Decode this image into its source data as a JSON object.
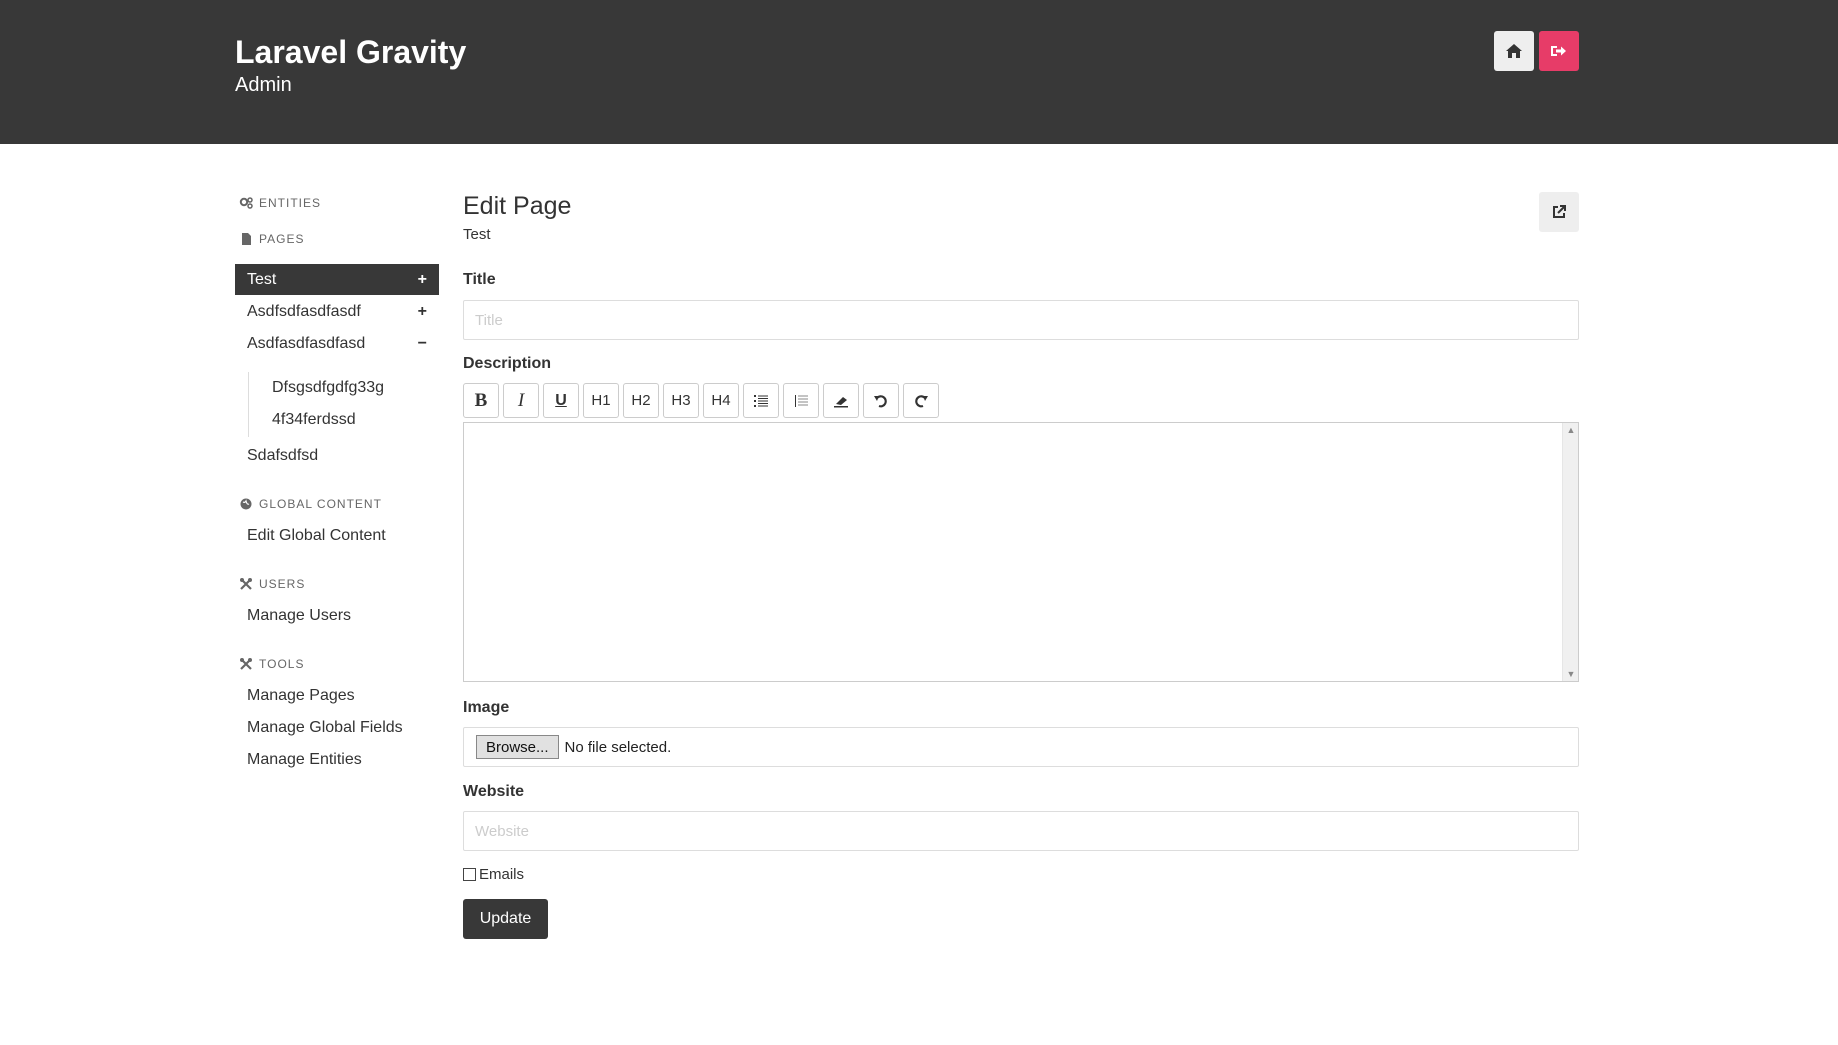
{
  "header": {
    "title": "Laravel Gravity",
    "subtitle": "Admin",
    "home_icon": "home-icon",
    "logout_icon": "sign-out-icon"
  },
  "sidebar": {
    "sections": {
      "entities": "ENTITIES",
      "pages": "PAGES",
      "global_content": "GLOBAL CONTENT",
      "users": "USERS",
      "tools": "TOOLS"
    },
    "pages": [
      {
        "label": "Test",
        "toggle": "+",
        "active": true
      },
      {
        "label": "Asdfsdfasdfasdf",
        "toggle": "+"
      },
      {
        "label": "Asdfasdfasdfasd",
        "toggle": "−"
      }
    ],
    "subpages": [
      "Dfsgsdfgdfg33g",
      "4f34ferdssd"
    ],
    "extra_page": "Sdafsdfsd",
    "global_content_items": [
      "Edit Global Content"
    ],
    "users_items": [
      "Manage Users"
    ],
    "tools_items": [
      "Manage Pages",
      "Manage Global Fields",
      "Manage Entities"
    ]
  },
  "main": {
    "title": "Edit Page",
    "subtitle": "Test",
    "title_label": "Title",
    "title_placeholder": "Title",
    "title_value": "",
    "description_label": "Description",
    "toolbar": [
      "B",
      "I",
      "U",
      "H1",
      "H2",
      "H3",
      "H4",
      "unordered-list-icon",
      "ordered-list-icon",
      "eraser-icon",
      "undo-icon",
      "redo-icon"
    ],
    "image_label": "Image",
    "browse_label": "Browse...",
    "no_file_text": "No file selected.",
    "website_label": "Website",
    "website_placeholder": "Website",
    "website_value": "",
    "emails_label": "Emails",
    "emails_checked": false,
    "update_label": "Update"
  },
  "colors": {
    "header_bg": "#383838",
    "accent_logout": "#e73c68",
    "active_nav_bg": "#383838"
  }
}
